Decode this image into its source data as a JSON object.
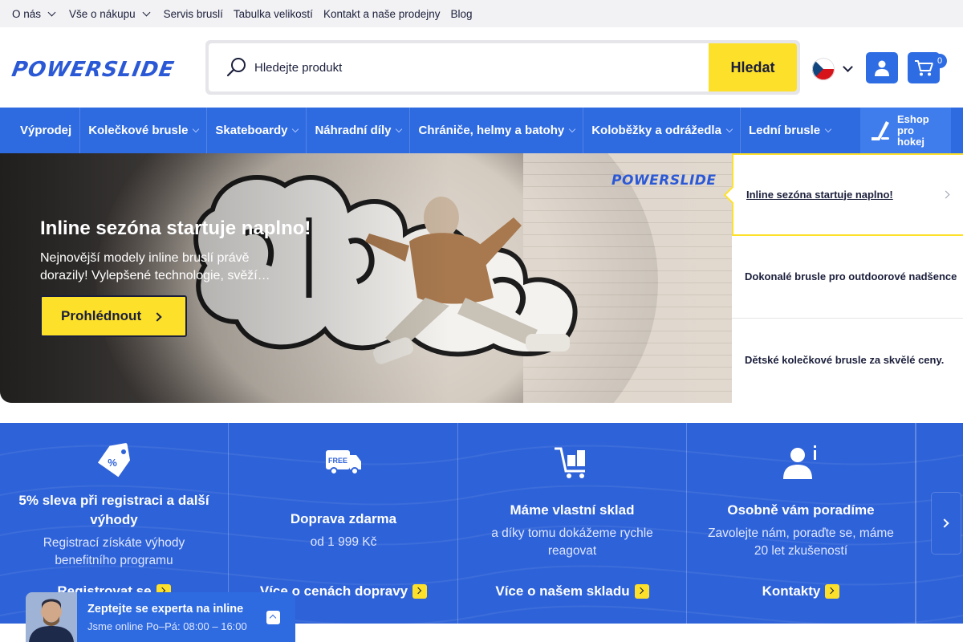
{
  "topbar": {
    "items": [
      {
        "label": "O nás",
        "dropdown": true
      },
      {
        "label": "Vše o nákupu",
        "dropdown": true
      },
      {
        "label": "Servis bruslí",
        "dropdown": false
      },
      {
        "label": "Tabulka velikostí",
        "dropdown": false
      },
      {
        "label": "Kontakt a naše prodejny",
        "dropdown": false
      },
      {
        "label": "Blog",
        "dropdown": false
      }
    ]
  },
  "header": {
    "logo": "POWERSLIDE",
    "search_placeholder": "Hledejte produkt",
    "search_button": "Hledat",
    "cart_count": "0"
  },
  "nav": {
    "items": [
      {
        "label": "Výprodej",
        "dropdown": false
      },
      {
        "label": "Kolečkové brusle",
        "dropdown": true
      },
      {
        "label": "Skateboardy",
        "dropdown": true
      },
      {
        "label": "Náhradní díly",
        "dropdown": true
      },
      {
        "label": "Chrániče, helmy a batohy",
        "dropdown": true
      },
      {
        "label": "Koloběžky a odrážedla",
        "dropdown": true
      },
      {
        "label": "Lední brusle",
        "dropdown": true
      }
    ],
    "hockey_label": "Eshop pro hokej"
  },
  "hero": {
    "title": "Inline sezóna startuje naplno!",
    "text": "Nejnovější modely inline bruslí právě dorazily! Vylepšené technologie, svěží…",
    "button": "Prohlédnout",
    "brand": "POWERSLIDE"
  },
  "slides": [
    {
      "label": "Inline sezóna startuje naplno!",
      "active": true
    },
    {
      "label": "Dokonalé brusle pro outdoorové nadšence",
      "active": false
    },
    {
      "label": "Dětské kolečkové brusle za skvělé ceny.",
      "active": false
    }
  ],
  "benefits": [
    {
      "icon": "discount-tag-icon",
      "title": "5% sleva při registraci a další výhody",
      "text": "Registrací získáte výhody benefitního programu",
      "link": "Registrovat se"
    },
    {
      "icon": "free-delivery-truck-icon",
      "title": "Doprava zdarma",
      "text": "od 1 999 Kč",
      "link": "Více o cenách dopravy"
    },
    {
      "icon": "warehouse-cart-icon",
      "title": "Máme vlastní sklad",
      "text": "a díky tomu dokážeme rychle reagovat",
      "link": "Více o našem skladu"
    },
    {
      "icon": "expert-advice-icon",
      "title": "Osobně vám poradíme",
      "text": "Zavolejte nám, poraďte se, máme 20 let zkušeností",
      "link": "Kontakty"
    }
  ],
  "chat": {
    "title": "Zeptejte se experta na inline",
    "status": "Jsme online Po–Pá: 08:00 – 16:00"
  },
  "colors": {
    "primary_blue": "#2e6ae0",
    "accent_yellow": "#fde02a",
    "text_dark": "#1b1f3b"
  }
}
